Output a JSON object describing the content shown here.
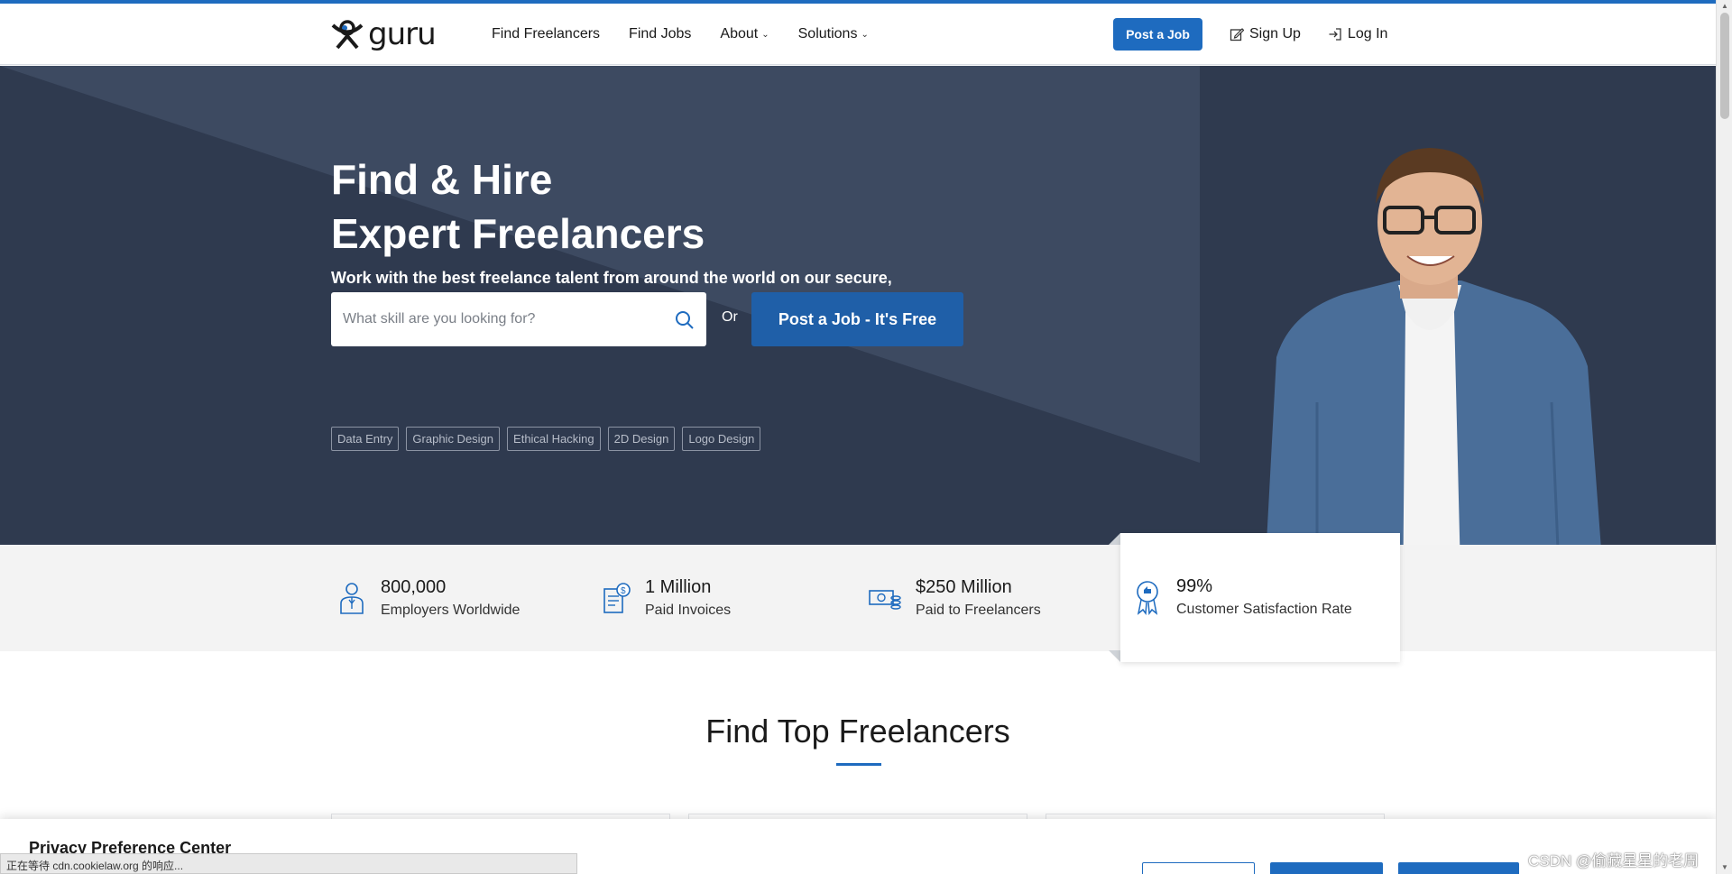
{
  "brand": {
    "logo_text": "guru"
  },
  "nav": {
    "links": [
      "Find Freelancers",
      "Find Jobs",
      "About",
      "Solutions"
    ],
    "post_job": "Post a Job",
    "sign_up": "Sign Up",
    "log_in": "Log In"
  },
  "hero": {
    "title_line1": "Find & Hire",
    "title_line2": "Expert Freelancers",
    "subtitle": "Work with the best freelance talent from around the world on our secure, flexible and cost-effective platform.",
    "search_placeholder": "What skill are you looking for?",
    "or": "Or",
    "cta": "Post a Job - It's Free",
    "tags": [
      "Data Entry",
      "Graphic Design",
      "Ethical Hacking",
      "2D Design",
      "Logo Design"
    ]
  },
  "stats": [
    {
      "value": "800,000",
      "label": "Employers Worldwide",
      "icon": "employer-icon"
    },
    {
      "value": "1 Million",
      "label": "Paid Invoices",
      "icon": "invoice-icon"
    },
    {
      "value": "$250 Million",
      "label": "Paid to Freelancers",
      "icon": "money-icon"
    },
    {
      "value": "99%",
      "label": "Customer Satisfaction Rate",
      "icon": "award-icon"
    }
  ],
  "section": {
    "title": "Find Top Freelancers"
  },
  "privacy": {
    "title": "Privacy Preference Center"
  },
  "status_bar": {
    "text": "正在等待 cdn.cookielaw.org 的响应..."
  },
  "watermark": "CSDN @偷藏星星的老周",
  "colors": {
    "accent": "#1e6bbf",
    "hero_bg": "#2f3a4f",
    "cta": "#1f5fa8"
  }
}
